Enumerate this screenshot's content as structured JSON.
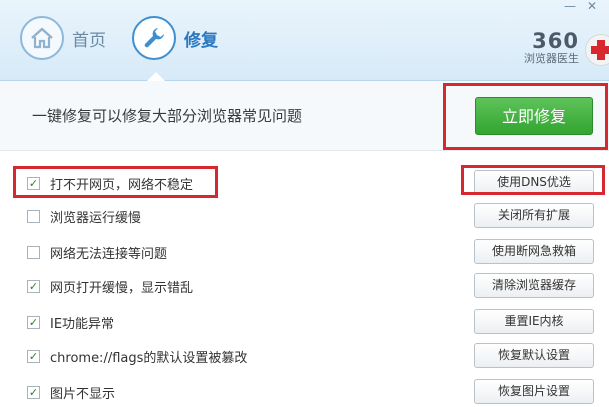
{
  "window": {
    "minimize_glyph": "—",
    "close_glyph": "✕"
  },
  "nav": {
    "home_label": "首页",
    "repair_label": "修复"
  },
  "brand": {
    "number": "360",
    "name": "浏览器医生"
  },
  "banner": {
    "text": "一键修复可以修复大部分浏览器常见问题",
    "fix_button": "立即修复"
  },
  "issues": [
    {
      "label": "打不开网页，网络不稳定",
      "checked": true,
      "action": "使用DNS优选"
    },
    {
      "label": "浏览器运行缓慢",
      "checked": false,
      "action": "关闭所有扩展"
    },
    {
      "label": "网络无法连接等问题",
      "checked": false,
      "action": "使用断网急救箱"
    },
    {
      "label": "网页打开缓慢，显示错乱",
      "checked": true,
      "action": "清除浏览器缓存"
    },
    {
      "label": "IE功能异常",
      "checked": true,
      "action": "重置IE内核"
    },
    {
      "label": "chrome://flags的默认设置被篡改",
      "checked": true,
      "action": "恢复默认设置"
    },
    {
      "label": "图片不显示",
      "checked": true,
      "action": "恢复图片设置"
    }
  ],
  "checkmark_glyph": "✓",
  "colors": {
    "accent_blue": "#2a78c0",
    "fix_green": "#33a431",
    "highlight_red": "#d8282f"
  }
}
